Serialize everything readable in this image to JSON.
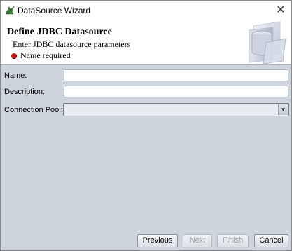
{
  "window": {
    "title": "DataSource Wizard",
    "close_glyph": "✕"
  },
  "header": {
    "title": "Define JDBC Datasource",
    "subtitle": "Enter JDBC datasource parameters",
    "status_text": "Name required",
    "status_color": "#cc1010"
  },
  "form": {
    "name_label": "Name:",
    "name_value": "",
    "description_label": "Description:",
    "description_value": "",
    "pool_label": "Connection Pool:",
    "pool_value": ""
  },
  "buttons": {
    "previous": "Previous",
    "next": "Next",
    "finish": "Finish",
    "cancel": "Cancel"
  },
  "icons": {
    "app": "wizard-app-icon",
    "banner": "database-folder-icon",
    "dropdown": "chevron-down-icon"
  }
}
